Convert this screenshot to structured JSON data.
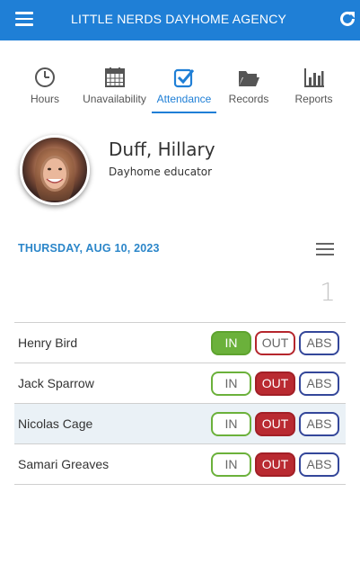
{
  "header": {
    "title": "LITTLE NERDS DAYHOME AGENCY",
    "accent_color": "#1f7fd6",
    "menu_icon": "hamburger-icon",
    "refresh_icon": "refresh-icon"
  },
  "tabs": [
    {
      "label": "Hours",
      "icon": "clock-icon",
      "active": false
    },
    {
      "label": "Unavailability",
      "icon": "calendar-icon",
      "active": false
    },
    {
      "label": "Attendance",
      "icon": "checkbox-icon",
      "active": true
    },
    {
      "label": "Records",
      "icon": "folder-icon",
      "active": false
    },
    {
      "label": "Reports",
      "icon": "bar-chart-icon",
      "active": false
    }
  ],
  "profile": {
    "name": "Duff, Hillary",
    "role": "Dayhome educator"
  },
  "attendance": {
    "date": "THURSDAY, AUG 10, 2023",
    "count": "1",
    "button_labels": {
      "in": "IN",
      "out": "OUT",
      "abs": "ABS"
    },
    "children": [
      {
        "name": "Henry Bird",
        "status": "in",
        "highlighted": false
      },
      {
        "name": "Jack Sparrow",
        "status": "out",
        "highlighted": false
      },
      {
        "name": "Nicolas Cage",
        "status": "out",
        "highlighted": true
      },
      {
        "name": "Samari Greaves",
        "status": "out",
        "highlighted": false
      }
    ]
  },
  "colors": {
    "in": "#6bb13b",
    "out": "#b92a31",
    "abs": "#34479a",
    "date": "#2b86c9"
  }
}
